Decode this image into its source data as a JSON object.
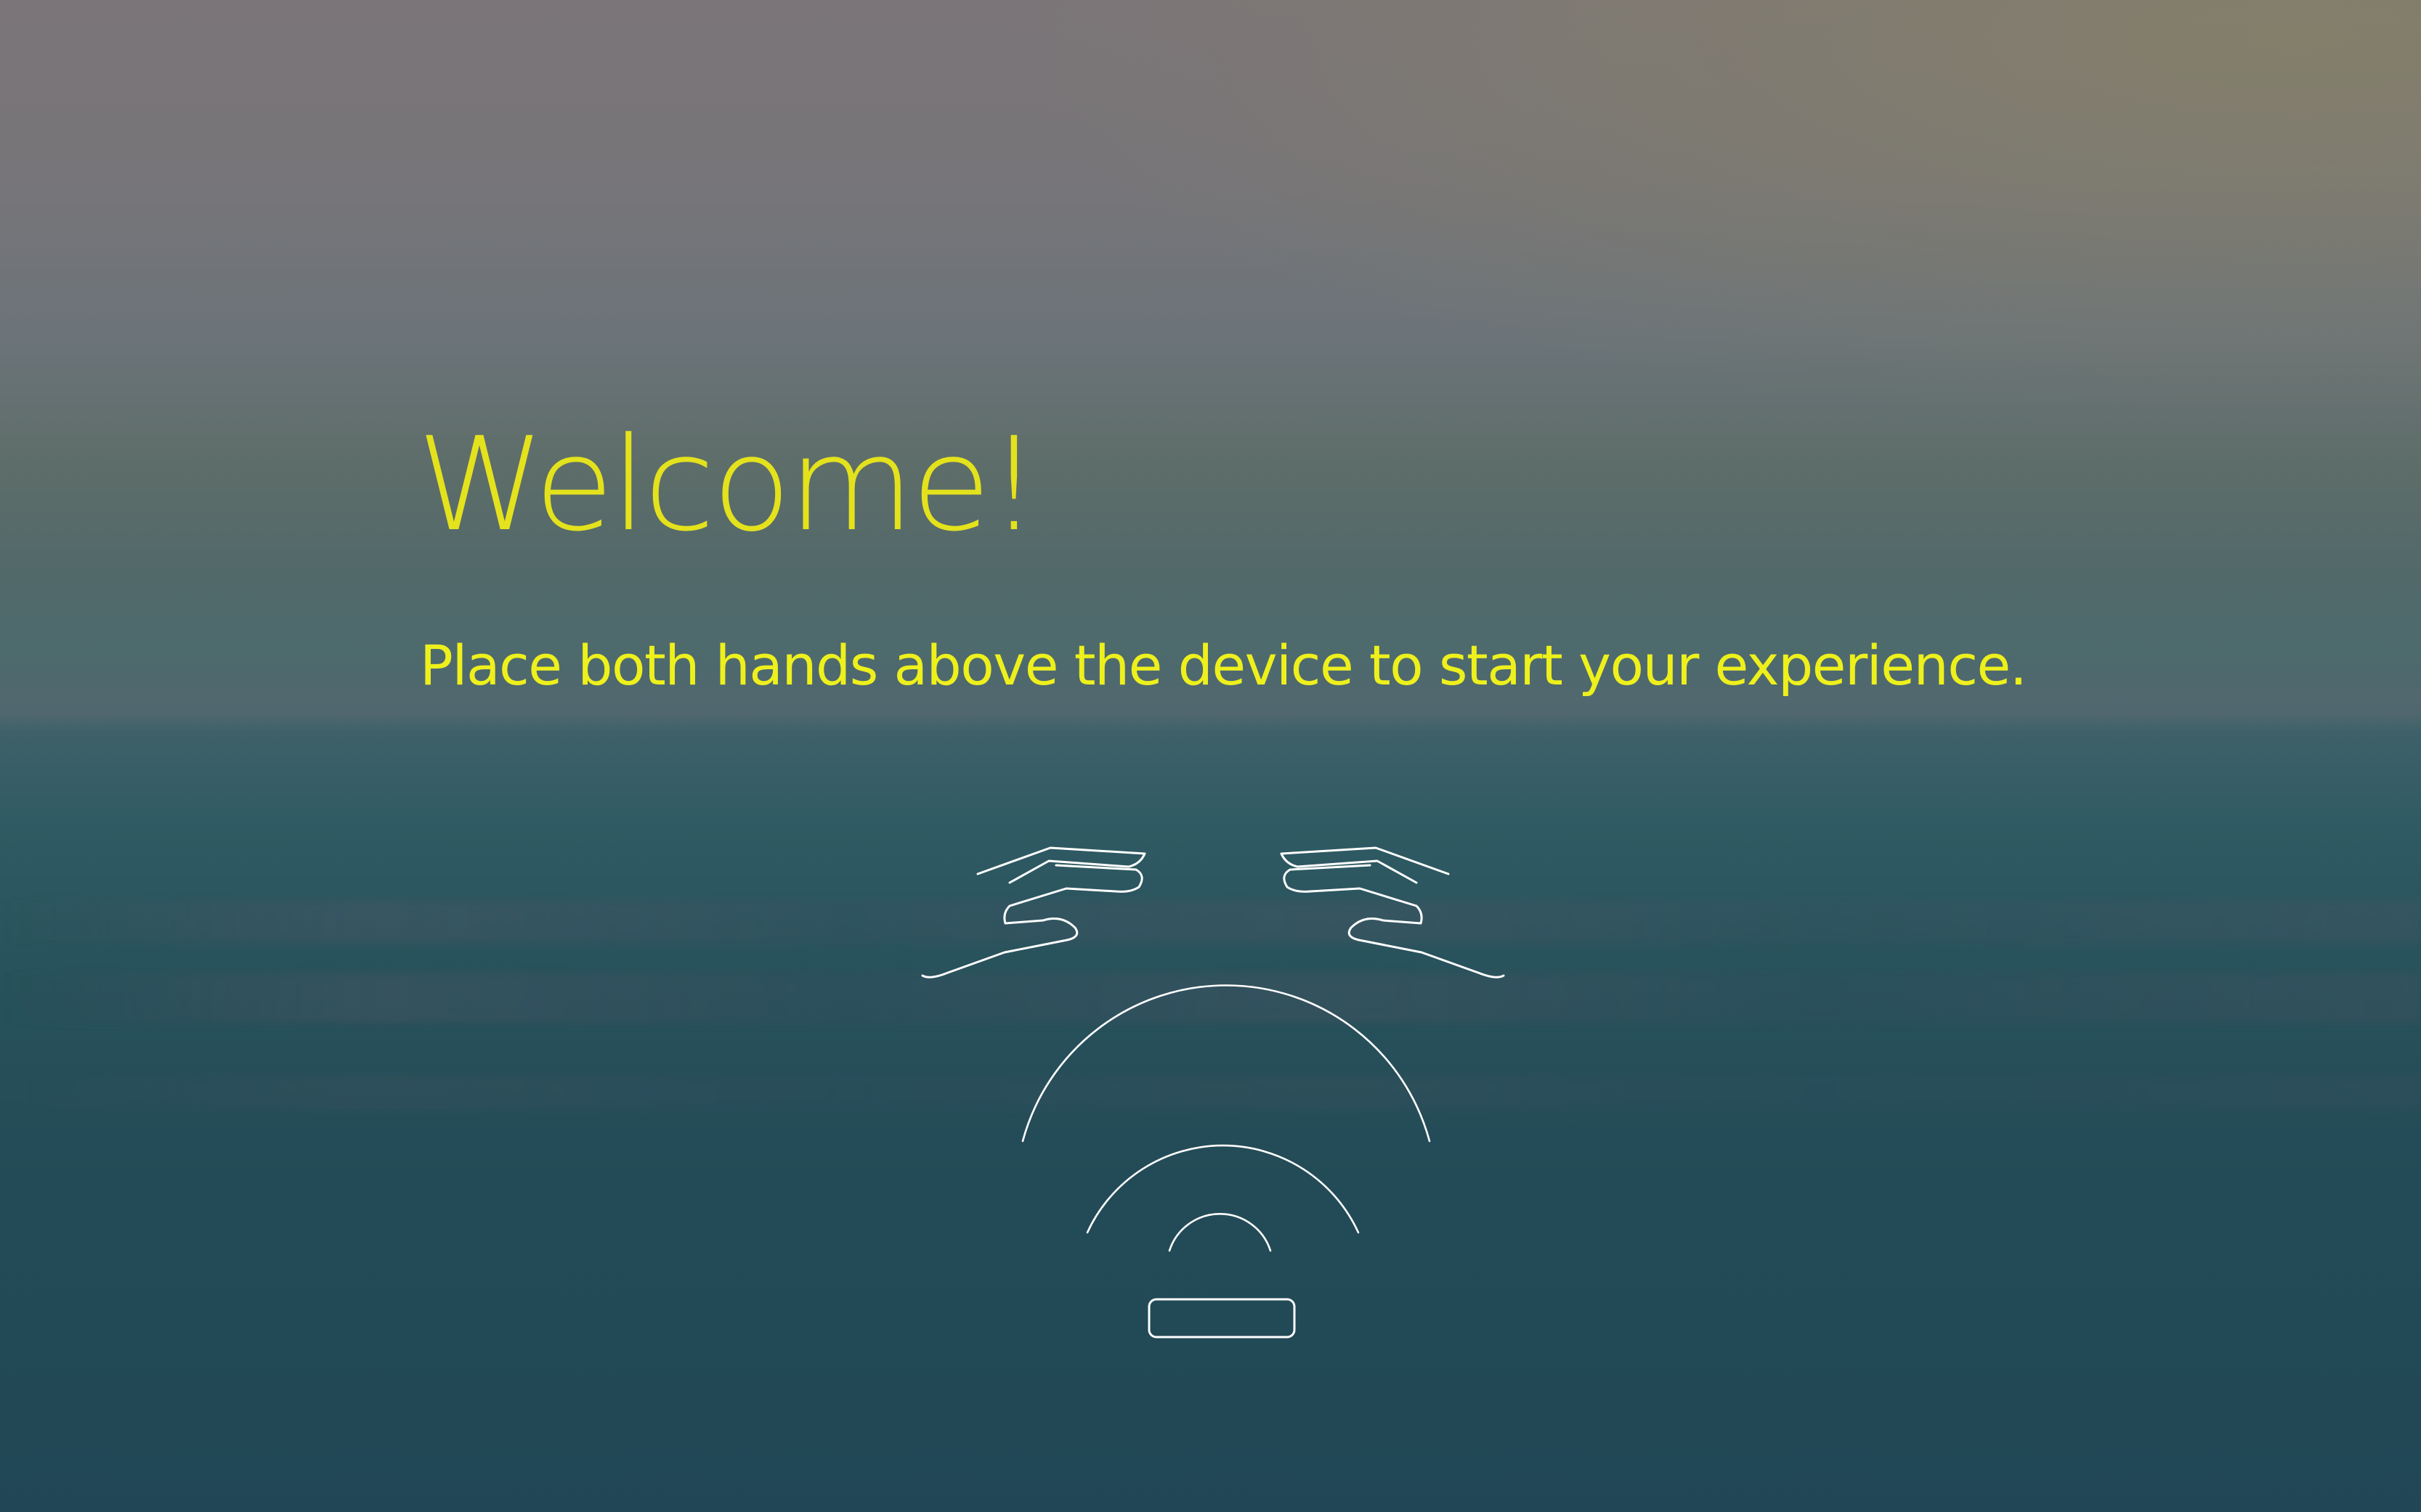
{
  "heading": {
    "title": "Welcome!",
    "instruction": "Place both hands above the device to start your experience."
  },
  "illustration": {
    "icons": [
      "left-hand-icon",
      "right-hand-icon",
      "signal-waves-icon",
      "sensor-device-icon"
    ],
    "stroke_color": "#ffffff"
  },
  "colors": {
    "text_accent": "#e9e61a",
    "sky_top": "#7b7579",
    "sea_bottom": "#214756"
  }
}
